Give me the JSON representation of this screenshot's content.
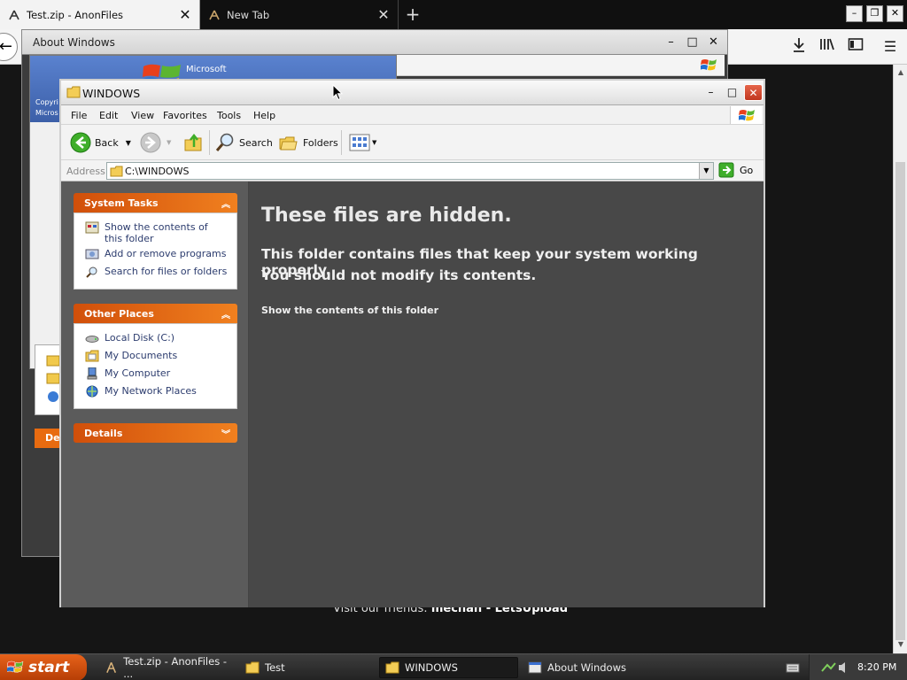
{
  "browser": {
    "tabs": [
      {
        "label": "Test.zip - AnonFiles",
        "active": true
      },
      {
        "label": "New Tab",
        "active": false
      }
    ],
    "footer_prefix": "Visit our friends:",
    "footer_links": "mechan - LetsUpload"
  },
  "about_window": {
    "title": "About Windows",
    "brand": "Microsoft",
    "copyright1": "Copyri",
    "copyright2": "Micros",
    "details": "De"
  },
  "explorer": {
    "title": "WINDOWS",
    "menu": [
      "File",
      "Edit",
      "View",
      "Favorites",
      "Tools",
      "Help"
    ],
    "toolbar": {
      "back": "Back",
      "search": "Search",
      "folders": "Folders"
    },
    "address": {
      "label": "Address",
      "value": "C:\\WINDOWS",
      "go": "Go"
    },
    "system_tasks": {
      "title": "System Tasks",
      "items": [
        "Show the contents of this folder",
        "Add or remove programs",
        "Search for files or folders"
      ]
    },
    "other_places": {
      "title": "Other Places",
      "items": [
        "Local Disk (C:)",
        "My Documents",
        "My Computer",
        "My Network Places"
      ]
    },
    "details": {
      "title": "Details"
    },
    "content": {
      "heading": "These files are hidden.",
      "line1": "This folder contains files that keep your system working properly.",
      "line2": "You should not modify its contents.",
      "link": "Show the contents of this folder"
    }
  },
  "taskbar": {
    "start": "start",
    "tasks": [
      "Test.zip - AnonFiles - ...",
      "Test",
      "WINDOWS",
      "About Windows"
    ],
    "active_task": "WINDOWS",
    "clock": "8:20 PM"
  },
  "colors": {
    "xp_orange": "#e86b10",
    "content_bg": "#484848",
    "start_orange": "#d4510d"
  }
}
